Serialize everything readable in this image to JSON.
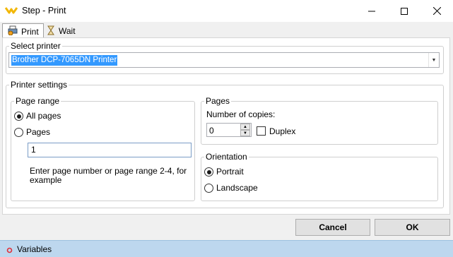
{
  "window": {
    "title": "Step - Print",
    "minimize_label": "—",
    "maximize_label": "☐",
    "close_label": "✕"
  },
  "tabs": [
    {
      "label": "Print"
    },
    {
      "label": "Wait"
    }
  ],
  "select_printer": {
    "legend": "Select printer",
    "value": "Brother DCP-7065DN Printer"
  },
  "printer_settings": {
    "legend": "Printer settings"
  },
  "page_range": {
    "legend": "Page range",
    "all_pages_label": "All pages",
    "pages_label": "Pages",
    "pages_value": "1",
    "hint": "Enter page number or page range 2-4, for example",
    "selected": "All pages"
  },
  "pages": {
    "legend": "Pages",
    "copies_label": "Number of copies:",
    "copies_value": "0",
    "duplex_label": "Duplex",
    "duplex_checked": false
  },
  "orientation": {
    "legend": "Orientation",
    "portrait_label": "Portrait",
    "landscape_label": "Landscape",
    "selected": "Portrait"
  },
  "buttons": {
    "cancel": "Cancel",
    "ok": "OK"
  },
  "statusbar": {
    "label": "Variables"
  },
  "colors": {
    "selection": "#3399ff",
    "statusbar": "#bdd7ee",
    "accent_red": "#e0303a"
  }
}
